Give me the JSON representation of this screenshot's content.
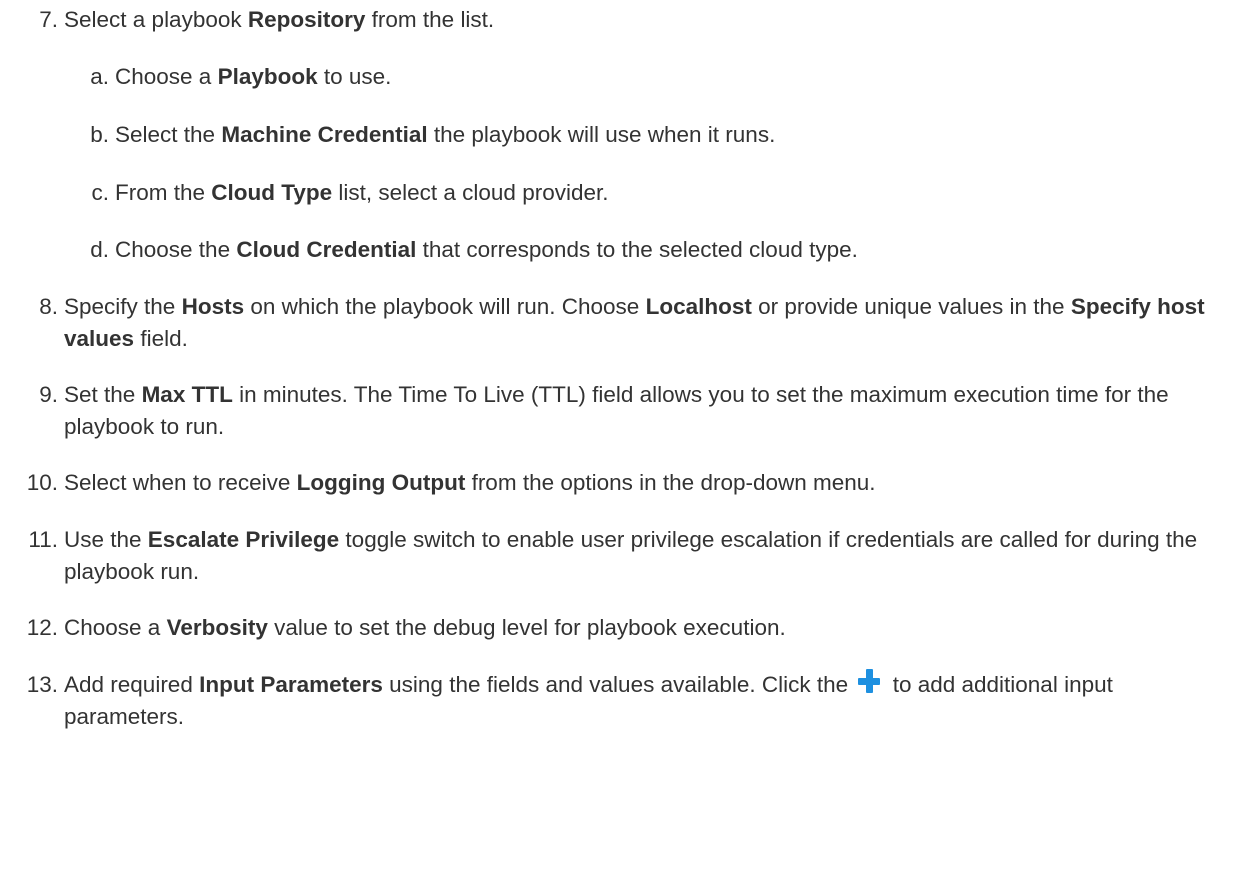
{
  "steps": {
    "s7": {
      "num": "7.",
      "t1": "Select a playbook ",
      "b1": "Repository",
      "t2": " from the list."
    },
    "s7a": {
      "num": "a.",
      "t1": "Choose a ",
      "b1": "Playbook",
      "t2": " to use."
    },
    "s7b": {
      "num": "b.",
      "t1": "Select the ",
      "b1": "Machine Credential",
      "t2": " the playbook will use when it runs."
    },
    "s7c": {
      "num": "c.",
      "t1": "From the ",
      "b1": "Cloud Type",
      "t2": " list, select a cloud provider."
    },
    "s7d": {
      "num": "d.",
      "t1": "Choose the ",
      "b1": "Cloud Credential",
      "t2": " that corresponds to the selected cloud type."
    },
    "s8": {
      "num": "8.",
      "t1": "Specify the ",
      "b1": "Hosts",
      "t2": " on which the playbook will run. Choose ",
      "b2": "Localhost",
      "t3": " or provide unique values in the ",
      "b3": "Specify host values",
      "t4": " field."
    },
    "s9": {
      "num": "9.",
      "t1": "Set the ",
      "b1": "Max TTL",
      "t2": " in minutes. The Time To Live (TTL) field allows you to set the maximum execution time for the playbook to run."
    },
    "s10": {
      "num": "10.",
      "t1": "Select when to receive ",
      "b1": "Logging Output",
      "t2": " from the options in the drop-down menu."
    },
    "s11": {
      "num": "11.",
      "t1": "Use the ",
      "b1": "Escalate Privilege",
      "t2": " toggle switch to enable user privilege escalation if credentials are called for during the playbook run."
    },
    "s12": {
      "num": "12.",
      "t1": "Choose a ",
      "b1": "Verbosity",
      "t2": " value to set the debug level for playbook execution."
    },
    "s13": {
      "num": "13.",
      "t1": "Add required ",
      "b1": "Input Parameters",
      "t2": " using the fields and values available. Click the ",
      "icon": "plus-icon",
      "t3": " to add additional input parameters."
    }
  },
  "colors": {
    "text": "#333333",
    "icon_blue": "#1e90e0"
  }
}
